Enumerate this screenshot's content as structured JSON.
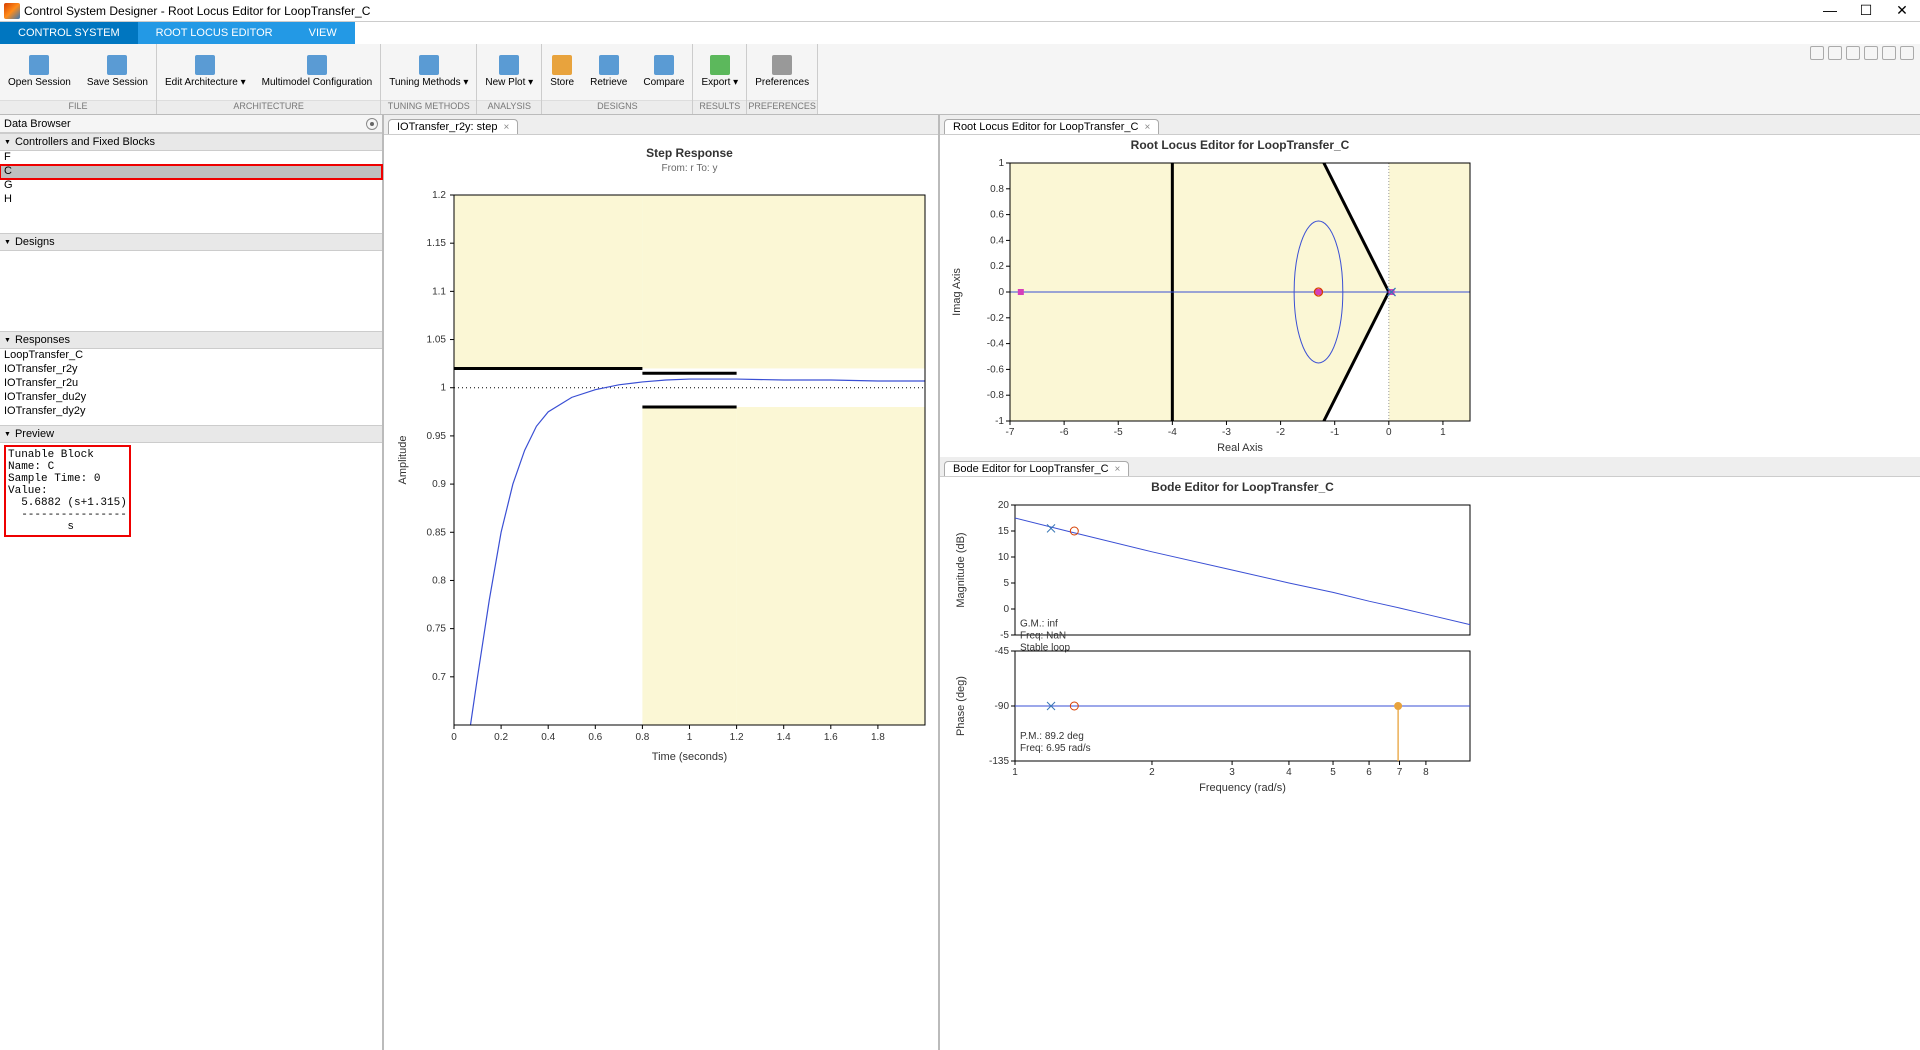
{
  "window": {
    "title": "Control System Designer - Root Locus Editor for LoopTransfer_C"
  },
  "ribbon_tabs": [
    {
      "label": "CONTROL SYSTEM",
      "active": true
    },
    {
      "label": "ROOT LOCUS EDITOR",
      "active": false
    },
    {
      "label": "VIEW",
      "active": false
    }
  ],
  "toolbar": {
    "groups": [
      {
        "label": "FILE",
        "items": [
          {
            "label": "Open\nSession",
            "icon": "folder"
          },
          {
            "label": "Save\nSession",
            "icon": "disk"
          }
        ]
      },
      {
        "label": "ARCHITECTURE",
        "items": [
          {
            "label": "Edit\nArchitecture ▾",
            "icon": "block"
          },
          {
            "label": "Multimodel\nConfiguration",
            "icon": "cfg"
          }
        ]
      },
      {
        "label": "TUNING METHODS",
        "items": [
          {
            "label": "Tuning\nMethods ▾",
            "icon": "dial"
          }
        ]
      },
      {
        "label": "ANALYSIS",
        "items": [
          {
            "label": "New\nPlot ▾",
            "icon": "plot"
          }
        ]
      },
      {
        "label": "DESIGNS",
        "items": [
          {
            "label": "Store",
            "icon": "star"
          },
          {
            "label": "Retrieve",
            "icon": "arrow"
          },
          {
            "label": "Compare",
            "icon": "cmp"
          }
        ]
      },
      {
        "label": "RESULTS",
        "items": [
          {
            "label": "Export\n▾",
            "icon": "export"
          }
        ]
      },
      {
        "label": "PREFERENCES",
        "items": [
          {
            "label": "Preferences",
            "icon": "gear"
          }
        ]
      }
    ]
  },
  "databrowser": {
    "title": "Data Browser"
  },
  "sections": {
    "controllers": {
      "title": "Controllers and Fixed Blocks",
      "items": [
        "F",
        "C",
        "G",
        "H"
      ],
      "selected": "C"
    },
    "designs": {
      "title": "Designs"
    },
    "responses": {
      "title": "Responses",
      "items": [
        "LoopTransfer_C",
        "IOTransfer_r2y",
        "IOTransfer_r2u",
        "IOTransfer_du2y",
        "IOTransfer_dy2y"
      ]
    },
    "preview": {
      "title": "Preview",
      "text": "Tunable Block\nName: C\nSample Time: 0\nValue:\n  5.6882 (s+1.315)\n  ----------------\n         s"
    }
  },
  "step_tab": {
    "label": "IOTransfer_r2y: step"
  },
  "rootlocus_tab": {
    "label": "Root Locus Editor for LoopTransfer_C"
  },
  "bode_tab": {
    "label": "Bode Editor for LoopTransfer_C"
  },
  "chart_data": [
    {
      "type": "line",
      "title": "Step Response",
      "subtitle": "From: r  To: y",
      "xlabel": "Time (seconds)",
      "ylabel": "Amplitude",
      "xlim": [
        0,
        2
      ],
      "ylim": [
        0.65,
        1.2
      ],
      "xticks": [
        0,
        0.2,
        0.4,
        0.6,
        0.8,
        1,
        1.2,
        1.4,
        1.6,
        1.8
      ],
      "yticks": [
        0.7,
        0.75,
        0.8,
        0.85,
        0.9,
        0.95,
        1,
        1.05,
        1.1,
        1.15,
        1.2
      ],
      "final_value": 1.0,
      "regions": [
        {
          "type": "forbidden-upper",
          "x": [
            0,
            0.8
          ],
          "y_above": 1.02
        },
        {
          "type": "forbidden-lower",
          "x": [
            0.8,
            1.2
          ],
          "y_below": 0.98
        },
        {
          "type": "forbidden-lower-right",
          "x": [
            1.2,
            2.0
          ],
          "y_below": 0.98,
          "y_above": 1.02
        }
      ],
      "series": [
        {
          "name": "step",
          "x": [
            0.07,
            0.1,
            0.15,
            0.2,
            0.25,
            0.3,
            0.35,
            0.4,
            0.5,
            0.6,
            0.7,
            0.8,
            0.9,
            1.0,
            1.2,
            1.4,
            1.6,
            1.8,
            2.0
          ],
          "y": [
            0.65,
            0.7,
            0.78,
            0.85,
            0.9,
            0.935,
            0.96,
            0.975,
            0.99,
            0.998,
            1.003,
            1.006,
            1.008,
            1.009,
            1.009,
            1.008,
            1.008,
            1.007,
            1.007
          ]
        }
      ]
    },
    {
      "type": "rootlocus",
      "title": "Root Locus Editor for LoopTransfer_C",
      "xlabel": "Real Axis",
      "ylabel": "Imag Axis",
      "xlim": [
        -7,
        1.5
      ],
      "ylim": [
        -1,
        1
      ],
      "xticks": [
        -7,
        -6,
        -5,
        -4,
        -3,
        -2,
        -1,
        0,
        1
      ],
      "yticks": [
        -1,
        -0.8,
        -0.6,
        -0.4,
        -0.2,
        0,
        0.2,
        0.4,
        0.6,
        0.8,
        1
      ],
      "design_region_right_of": 0,
      "design_cone_vertex": [
        0,
        0
      ],
      "root_locus_real_segment": [
        -7,
        1.5
      ],
      "poles": [
        {
          "re": -1.3,
          "im": 0
        }
      ],
      "zeros": [
        {
          "re": 0,
          "im": 0
        }
      ],
      "closed_loop_poles": [
        {
          "re": -6.8,
          "im": 0
        },
        {
          "re": -1.3,
          "im": 0
        },
        {
          "re": 0.05,
          "im": 0
        }
      ],
      "ellipse": {
        "cx": -1.3,
        "cy": 0,
        "rx": 0.45,
        "ry": 0.55
      },
      "v_line_at": -4
    },
    {
      "type": "bode",
      "title": "Bode Editor for LoopTransfer_C",
      "xlabel": "Frequency (rad/s)",
      "xlim_log": [
        1,
        10
      ],
      "xticks": [
        1,
        2,
        3,
        4,
        5,
        6,
        7,
        8
      ],
      "mag": {
        "ylabel": "Magnitude (dB)",
        "ylim": [
          -5,
          20
        ],
        "yticks": [
          -5,
          0,
          5,
          10,
          15,
          20
        ],
        "gm_text": "G.M.: inf",
        "freq_text": "Freq: NaN",
        "stable_text": "Stable loop",
        "series": {
          "x": [
            1,
            1.3,
            2,
            3,
            4,
            5,
            6,
            7,
            8,
            10
          ],
          "y": [
            17.5,
            15,
            11,
            7.5,
            5,
            3.2,
            1.5,
            0.2,
            -1,
            -3
          ]
        },
        "markers": [
          {
            "type": "x",
            "x": 1.2,
            "y": 15.5,
            "color": "#3a77b5"
          },
          {
            "type": "o",
            "x": 1.35,
            "y": 15,
            "color": "#d63e00"
          }
        ]
      },
      "phase": {
        "ylabel": "Phase (deg)",
        "ylim": [
          -135,
          -45
        ],
        "yticks": [
          -135,
          -90,
          -45
        ],
        "pm_text": "P.M.: 89.2 deg",
        "freq_text": "Freq: 6.95 rad/s",
        "series": {
          "x": [
            1,
            2,
            3,
            4,
            5,
            6,
            7,
            8,
            10
          ],
          "y": [
            -90,
            -90,
            -90,
            -90,
            -90,
            -90,
            -90,
            -90,
            -90
          ]
        },
        "markers": [
          {
            "type": "x",
            "x": 1.2,
            "y": -90,
            "color": "#3a77b5"
          },
          {
            "type": "o",
            "x": 1.35,
            "y": -90,
            "color": "#d63e00"
          }
        ],
        "crossover_marker": {
          "x": 6.95,
          "y": -90,
          "color": "#e8a33d"
        }
      }
    }
  ]
}
